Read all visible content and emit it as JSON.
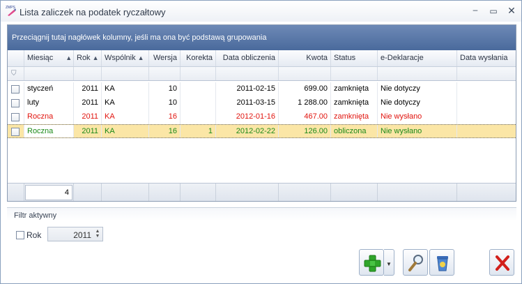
{
  "window": {
    "title": "Lista zaliczek na podatek ryczałtowy",
    "app_icon_text": "ZMPS"
  },
  "grid": {
    "group_hint": "Przeciągnij tutaj nagłówek kolumny, jeśli ma ona być podstawą grupowania",
    "columns": [
      "Miesiąc",
      "Rok",
      "Wspólnik",
      "Wersja",
      "Korekta",
      "Data obliczenia",
      "Kwota",
      "Status",
      "e-Deklaracje",
      "Data wysłania"
    ],
    "rows": [
      {
        "miesiac": "styczeń",
        "rok": "2011",
        "wspolnik": "KA",
        "wersja": "10",
        "korekta": "",
        "data": "2011-02-15",
        "kwota": "699.00",
        "status": "zamknięta",
        "edekl": "Nie dotyczy",
        "wyslania": "",
        "color": "#000000"
      },
      {
        "miesiac": "luty",
        "rok": "2011",
        "wspolnik": "KA",
        "wersja": "10",
        "korekta": "",
        "data": "2011-03-15",
        "kwota": "1 288.00",
        "status": "zamknięta",
        "edekl": "Nie dotyczy",
        "wyslania": "",
        "color": "#000000"
      },
      {
        "miesiac": "Roczna",
        "rok": "2011",
        "wspolnik": "KA",
        "wersja": "16",
        "korekta": "",
        "data": "2012-01-16",
        "kwota": "467.00",
        "status": "zamknięta",
        "edekl": "Nie wysłano",
        "wyslania": "",
        "color": "#e1140e"
      },
      {
        "miesiac": "Roczna",
        "rok": "2011",
        "wspolnik": "KA",
        "wersja": "16",
        "korekta": "1",
        "data": "2012-02-22",
        "kwota": "126.00",
        "status": "obliczona",
        "edekl": "Nie wysłano",
        "wyslania": "",
        "color": "#1c8a19"
      }
    ],
    "summary_count": "4"
  },
  "filter": {
    "title": "Filtr aktywny",
    "rok_label": "Rok",
    "rok_value": "2011"
  },
  "icons": {
    "add": "plus-icon",
    "search": "magnifier-icon",
    "delete": "trash-icon",
    "close": "close-x-icon"
  }
}
